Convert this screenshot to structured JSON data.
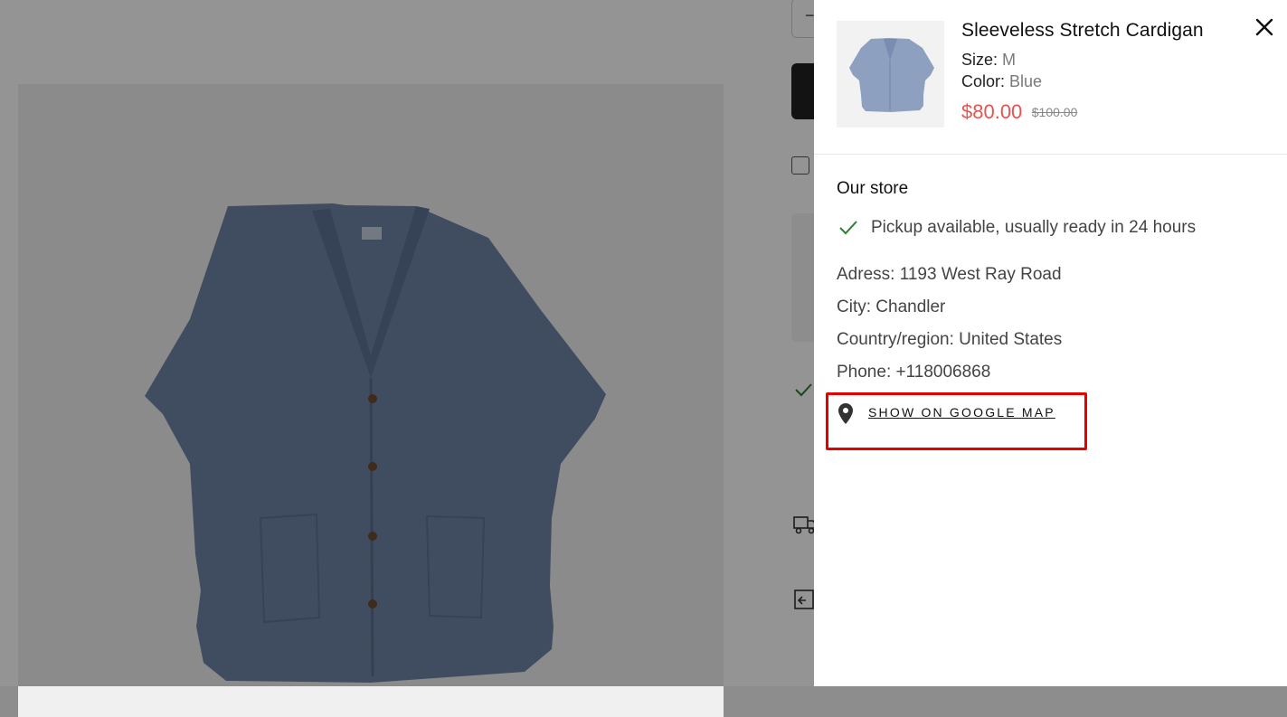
{
  "page": {
    "top_button_symbol": "−"
  },
  "drawer": {
    "product": {
      "title": "Sleeveless Stretch Cardigan",
      "size_label": "Size:",
      "size_value": "M",
      "color_label": "Color:",
      "color_value": "Blue",
      "price": "$80.00",
      "compare_price": "$100.00"
    },
    "store": {
      "title": "Our store",
      "pickup": "Pickup available, usually ready in 24 hours",
      "address": "Adress: 1193 West Ray Road",
      "city": "City: Chandler",
      "country": "Country/region: United States",
      "phone": "Phone: +118006868",
      "map_link": "SHOW ON GOOGLE MAP"
    }
  },
  "icons": {
    "close": "close-icon",
    "check": "check-icon",
    "map_pin": "map-pin-icon",
    "truck": "truck-icon",
    "return_box": "return-box-icon"
  },
  "colors": {
    "sale_price": "#e8524f",
    "highlight": "#e60000",
    "check": "#2e7d32",
    "cardigan": "#6f86a8"
  }
}
